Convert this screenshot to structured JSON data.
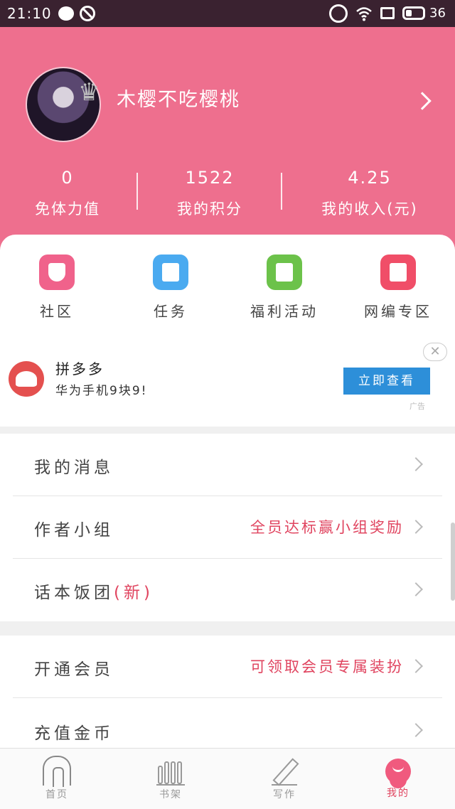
{
  "status_bar": {
    "time": "21:10",
    "battery": "36"
  },
  "profile": {
    "username": "木樱不吃樱桃"
  },
  "stats": [
    {
      "value": "0",
      "label": "免体力值"
    },
    {
      "value": "1522",
      "label": "我的积分"
    },
    {
      "value": "4.25",
      "label": "我的收入(元)"
    }
  ],
  "grid": [
    {
      "label": "社区",
      "icon": "community-icon",
      "color": "#f0628b"
    },
    {
      "label": "任务",
      "icon": "task-icon",
      "color": "#4aaaf0"
    },
    {
      "label": "福利活动",
      "icon": "welfare-icon",
      "color": "#6cc24a"
    },
    {
      "label": "网编专区",
      "icon": "gift-icon",
      "color": "#f04e68"
    }
  ],
  "ad": {
    "title": "拼多多",
    "desc": "华为手机9块9!",
    "button": "立即查看",
    "close": "✕",
    "tag": "广告"
  },
  "menu_group1": [
    {
      "label": "我的消息",
      "hint": ""
    },
    {
      "label": "作者小组",
      "hint": "全员达标赢小组奖励"
    },
    {
      "label": "话本饭团",
      "badge": "(新)",
      "hint": ""
    }
  ],
  "menu_group2": [
    {
      "label": "开通会员",
      "hint": "可领取会员专属装扮"
    },
    {
      "label": "充值金币",
      "hint": ""
    }
  ],
  "bottom_nav": [
    {
      "label": "首页",
      "icon": "home-icon"
    },
    {
      "label": "书架",
      "icon": "bookshelf-icon"
    },
    {
      "label": "写作",
      "icon": "pen-icon"
    },
    {
      "label": "我的",
      "icon": "mine-icon",
      "active": true
    }
  ]
}
